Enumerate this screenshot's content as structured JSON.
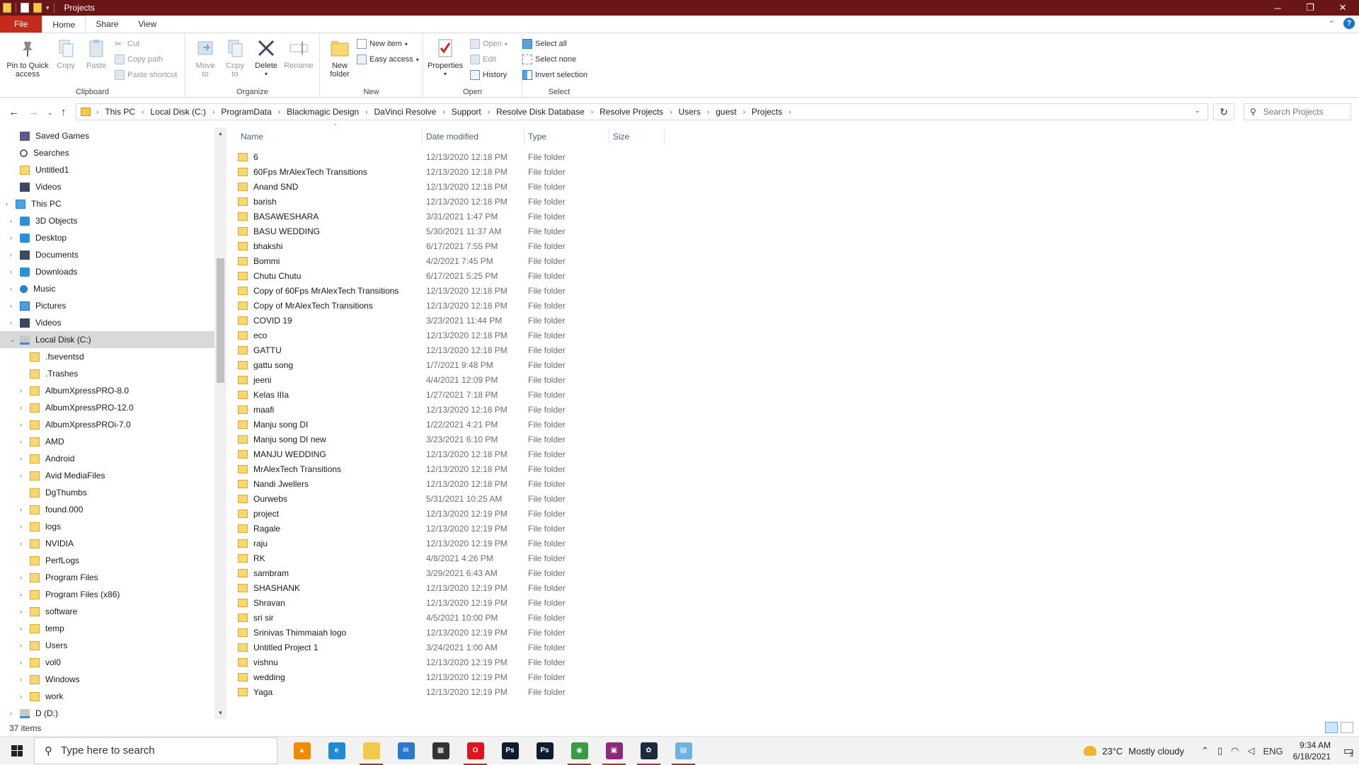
{
  "window": {
    "title": "Projects",
    "controls": {
      "minimize": "─",
      "maximize": "❐",
      "close": "✕"
    }
  },
  "ribbon_tabs": [
    {
      "label": "File"
    },
    {
      "label": "Home"
    },
    {
      "label": "Share"
    },
    {
      "label": "View"
    }
  ],
  "ribbon": {
    "clipboard": {
      "label": "Clipboard",
      "pin": "Pin to Quick",
      "pin2": "access",
      "copy": "Copy",
      "paste": "Paste",
      "cut": "Cut",
      "copy_path": "Copy path",
      "paste_shortcut": "Paste shortcut"
    },
    "organize": {
      "label": "Organize",
      "move_to": "Move",
      "move_to2": "to",
      "copy_to": "Copy",
      "copy_to2": "to",
      "delete": "Delete",
      "rename": "Rename"
    },
    "new": {
      "label": "New",
      "new_folder": "New",
      "new_folder2": "folder",
      "new_item": "New item",
      "easy_access": "Easy access"
    },
    "open": {
      "label": "Open",
      "properties": "Properties",
      "open": "Open",
      "edit": "Edit",
      "history": "History"
    },
    "select": {
      "label": "Select",
      "select_all": "Select all",
      "select_none": "Select none",
      "invert": "Invert selection"
    }
  },
  "address": {
    "crumbs": [
      "This PC",
      "Local Disk (C:)",
      "ProgramData",
      "Blackmagic Design",
      "DaVinci Resolve",
      "Support",
      "Resolve Disk Database",
      "Resolve Projects",
      "Users",
      "guest",
      "Projects"
    ],
    "search_placeholder": "Search Projects"
  },
  "sidebar": [
    {
      "label": "Saved Games",
      "icon": "games",
      "indent": 1
    },
    {
      "label": "Searches",
      "icon": "search-i",
      "indent": 1
    },
    {
      "label": "Untitled1",
      "icon": "folder",
      "indent": 1
    },
    {
      "label": "Videos",
      "icon": "dark",
      "indent": 1
    },
    {
      "label": "This PC",
      "icon": "pc",
      "indent": 0,
      "expander": "›"
    },
    {
      "label": "3D Objects",
      "icon": "blue",
      "indent": 1,
      "expander": "›"
    },
    {
      "label": "Desktop",
      "icon": "blue",
      "indent": 1,
      "expander": "›"
    },
    {
      "label": "Documents",
      "icon": "dark",
      "indent": 1,
      "expander": "›"
    },
    {
      "label": "Downloads",
      "icon": "blue",
      "indent": 1,
      "expander": "›"
    },
    {
      "label": "Music",
      "icon": "music",
      "indent": 1,
      "expander": "›"
    },
    {
      "label": "Pictures",
      "icon": "pic",
      "indent": 1,
      "expander": "›"
    },
    {
      "label": "Videos",
      "icon": "dark",
      "indent": 1,
      "expander": "›"
    },
    {
      "label": "Local Disk (C:)",
      "icon": "drive",
      "indent": 1,
      "expander": "⌄",
      "selected": true
    },
    {
      "label": ".fseventsd",
      "icon": "folder",
      "indent": 2
    },
    {
      "label": ".Trashes",
      "icon": "folder",
      "indent": 2
    },
    {
      "label": "AlbumXpressPRO-8.0",
      "icon": "folder",
      "indent": 2,
      "expander": "›"
    },
    {
      "label": "AlbumXpressPRO-12.0",
      "icon": "folder",
      "indent": 2,
      "expander": "›"
    },
    {
      "label": "AlbumXpressPROi-7.0",
      "icon": "folder",
      "indent": 2,
      "expander": "›"
    },
    {
      "label": "AMD",
      "icon": "folder",
      "indent": 2,
      "expander": "›"
    },
    {
      "label": "Android",
      "icon": "folder",
      "indent": 2,
      "expander": "›"
    },
    {
      "label": "Avid MediaFiles",
      "icon": "folder",
      "indent": 2,
      "expander": "›"
    },
    {
      "label": "DgThumbs",
      "icon": "folder",
      "indent": 2
    },
    {
      "label": "found.000",
      "icon": "folder",
      "indent": 2,
      "expander": "›"
    },
    {
      "label": "logs",
      "icon": "folder",
      "indent": 2,
      "expander": "›"
    },
    {
      "label": "NVIDIA",
      "icon": "folder",
      "indent": 2,
      "expander": "›"
    },
    {
      "label": "PerfLogs",
      "icon": "folder",
      "indent": 2
    },
    {
      "label": "Program Files",
      "icon": "folder",
      "indent": 2,
      "expander": "›"
    },
    {
      "label": "Program Files (x86)",
      "icon": "folder",
      "indent": 2,
      "expander": "›"
    },
    {
      "label": "software",
      "icon": "folder",
      "indent": 2,
      "expander": "›"
    },
    {
      "label": "temp",
      "icon": "folder",
      "indent": 2,
      "expander": "›"
    },
    {
      "label": "Users",
      "icon": "folder",
      "indent": 2,
      "expander": "›"
    },
    {
      "label": "vol0",
      "icon": "folder",
      "indent": 2,
      "expander": "›"
    },
    {
      "label": "Windows",
      "icon": "folder",
      "indent": 2,
      "expander": "›"
    },
    {
      "label": "work",
      "icon": "folder",
      "indent": 2,
      "expander": "›"
    },
    {
      "label": "D (D:)",
      "icon": "drive",
      "indent": 1,
      "expander": "›"
    }
  ],
  "columns": {
    "name": "Name",
    "date": "Date modified",
    "type": "Type",
    "size": "Size"
  },
  "files": [
    {
      "name": "6",
      "date": "12/13/2020 12:18 PM",
      "type": "File folder"
    },
    {
      "name": "60Fps MrAlexTech Transitions",
      "date": "12/13/2020 12:18 PM",
      "type": "File folder"
    },
    {
      "name": "Anand SND",
      "date": "12/13/2020 12:18 PM",
      "type": "File folder"
    },
    {
      "name": "barish",
      "date": "12/13/2020 12:18 PM",
      "type": "File folder"
    },
    {
      "name": "BASAWESHARA",
      "date": "3/31/2021 1:47 PM",
      "type": "File folder"
    },
    {
      "name": "BASU WEDDING",
      "date": "5/30/2021 11:37 AM",
      "type": "File folder"
    },
    {
      "name": "bhakshi",
      "date": "6/17/2021 7:55 PM",
      "type": "File folder"
    },
    {
      "name": "Bommi",
      "date": "4/2/2021 7:45 PM",
      "type": "File folder"
    },
    {
      "name": "Chutu Chutu",
      "date": "6/17/2021 5:25 PM",
      "type": "File folder"
    },
    {
      "name": "Copy of 60Fps MrAlexTech Transitions",
      "date": "12/13/2020 12:18 PM",
      "type": "File folder"
    },
    {
      "name": "Copy of MrAlexTech Transitions",
      "date": "12/13/2020 12:18 PM",
      "type": "File folder"
    },
    {
      "name": "COVID 19",
      "date": "3/23/2021 11:44 PM",
      "type": "File folder"
    },
    {
      "name": "eco",
      "date": "12/13/2020 12:18 PM",
      "type": "File folder"
    },
    {
      "name": "GATTU",
      "date": "12/13/2020 12:18 PM",
      "type": "File folder"
    },
    {
      "name": "gattu song",
      "date": "1/7/2021 9:48 PM",
      "type": "File folder"
    },
    {
      "name": "jeeni",
      "date": "4/4/2021 12:09 PM",
      "type": "File folder"
    },
    {
      "name": "Kelas IIIa",
      "date": "1/27/2021 7:18 PM",
      "type": "File folder"
    },
    {
      "name": "maafi",
      "date": "12/13/2020 12:18 PM",
      "type": "File folder"
    },
    {
      "name": "Manju song DI",
      "date": "1/22/2021 4:21 PM",
      "type": "File folder"
    },
    {
      "name": "Manju song DI new",
      "date": "3/23/2021 6:10 PM",
      "type": "File folder"
    },
    {
      "name": "MANJU WEDDING",
      "date": "12/13/2020 12:18 PM",
      "type": "File folder"
    },
    {
      "name": "MrAlexTech Transitions",
      "date": "12/13/2020 12:18 PM",
      "type": "File folder"
    },
    {
      "name": "Nandi Jwellers",
      "date": "12/13/2020 12:18 PM",
      "type": "File folder"
    },
    {
      "name": "Ourwebs",
      "date": "5/31/2021 10:25 AM",
      "type": "File folder"
    },
    {
      "name": "project",
      "date": "12/13/2020 12:19 PM",
      "type": "File folder"
    },
    {
      "name": "Ragale",
      "date": "12/13/2020 12:19 PM",
      "type": "File folder"
    },
    {
      "name": "raju",
      "date": "12/13/2020 12:19 PM",
      "type": "File folder"
    },
    {
      "name": "RK",
      "date": "4/8/2021 4:26 PM",
      "type": "File folder"
    },
    {
      "name": "sambram",
      "date": "3/29/2021 6:43 AM",
      "type": "File folder"
    },
    {
      "name": "SHASHANK",
      "date": "12/13/2020 12:19 PM",
      "type": "File folder"
    },
    {
      "name": "Shravan",
      "date": "12/13/2020 12:19 PM",
      "type": "File folder"
    },
    {
      "name": "sri sir",
      "date": "4/5/2021 10:00 PM",
      "type": "File folder"
    },
    {
      "name": "Srinivas Thimmaiah logo",
      "date": "12/13/2020 12:19 PM",
      "type": "File folder"
    },
    {
      "name": "Untitled Project 1",
      "date": "3/24/2021 1:00 AM",
      "type": "File folder"
    },
    {
      "name": "vishnu",
      "date": "12/13/2020 12:19 PM",
      "type": "File folder"
    },
    {
      "name": "wedding",
      "date": "12/13/2020 12:19 PM",
      "type": "File folder"
    },
    {
      "name": "Yaga",
      "date": "12/13/2020 12:19 PM",
      "type": "File folder"
    }
  ],
  "status": {
    "count": "37 items"
  },
  "taskbar": {
    "search_placeholder": "Type here to search",
    "apps": [
      {
        "name": "vlc",
        "color": "#f08a00",
        "glyph": "▲"
      },
      {
        "name": "edge",
        "color": "#1f8ad6",
        "glyph": "e"
      },
      {
        "name": "file-explorer",
        "color": "#f3c94c",
        "glyph": "",
        "running": true
      },
      {
        "name": "mail",
        "color": "#2b78d0",
        "glyph": "✉"
      },
      {
        "name": "store",
        "color": "#333333",
        "glyph": "▦"
      },
      {
        "name": "opera",
        "color": "#e0141e",
        "glyph": "O",
        "running": true
      },
      {
        "name": "photoshop-1",
        "color": "#0f1b2e",
        "glyph": "Ps"
      },
      {
        "name": "photoshop-2",
        "color": "#0f1b2e",
        "glyph": "Ps"
      },
      {
        "name": "chrome",
        "color": "#3a9b45",
        "glyph": "◉",
        "running": true
      },
      {
        "name": "winrar",
        "color": "#8b2a7b",
        "glyph": "▣",
        "running": true
      },
      {
        "name": "davinci-resolve",
        "color": "#1d2a3c",
        "glyph": "✿",
        "running": true
      },
      {
        "name": "notepad",
        "color": "#6fb3e0",
        "glyph": "▤",
        "running": true
      }
    ],
    "weather": "23°C",
    "weather_desc": "Mostly cloudy",
    "lang": "ENG",
    "time": "9:34 AM",
    "date": "6/18/2021",
    "notif_count": "3"
  }
}
